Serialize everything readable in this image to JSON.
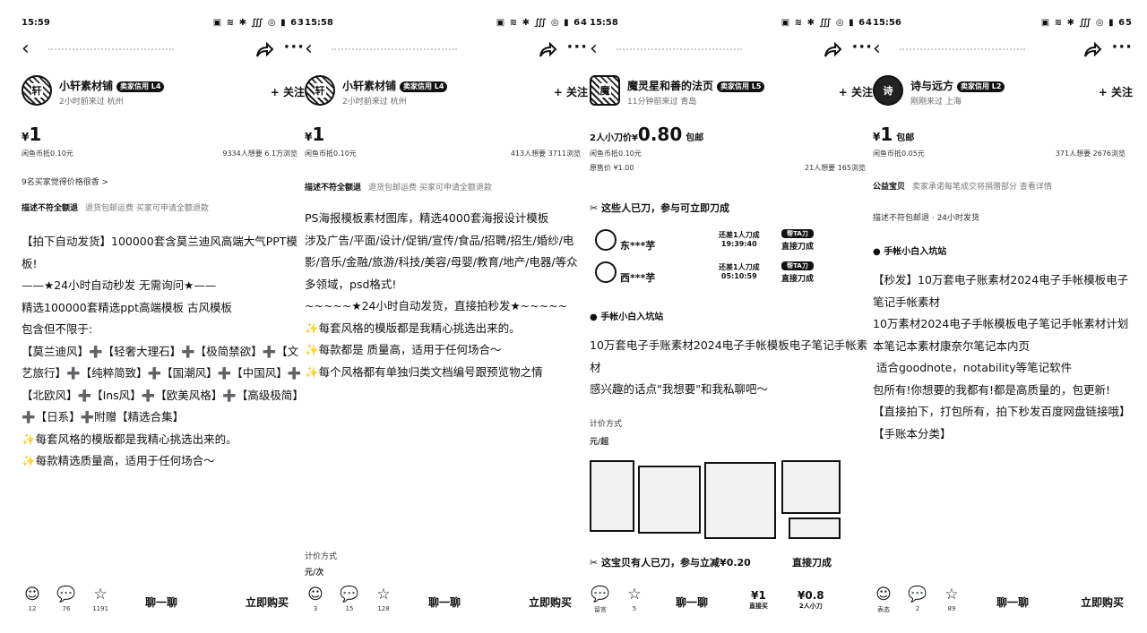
{
  "panels": [
    {
      "time": "15:59",
      "status_icons": "▣ ≋ ✱ ∭ ◎ ▮ 63",
      "seller_name": "小轩素材铺",
      "badge": "卖家信用 L4",
      "seller_meta": "2小时前来过  杭州",
      "follow": "+ 关注",
      "price_currency": "¥",
      "price": "1",
      "price_suffix": "",
      "price_sub": "闲鱼币抵0.10元",
      "stats": "9334人想要  6.1万浏览",
      "line1": "9名买家觉得价格很香 >",
      "tag_label": "描述不符全额退",
      "tag_text": "退货包邮运费  买家可申请全额退款",
      "desc": [
        "【拍下自动发货】100000套含莫兰迪风高端大气PPT模板!",
        "",
        "——★24小时自动秒发 无需询问★——",
        "",
        "精选100000套精选ppt高端模板 古风模板",
        "包含但不限于:",
        "【莫兰迪风】➕【轻奢大理石】➕【极简禁欲】➕【文艺旅行】➕【纯粹简致】➕【国潮风】➕【中国风】➕【北欧风】➕【Ins风】➕【欧美风格】➕【高级极简】➕【日系】➕附赠【精选合集】",
        "",
        "✨每套风格的模版都是我精心挑选出来的。",
        "",
        "✨每款精选质量高，适用于任何场合～"
      ],
      "counts": [
        "12",
        "76",
        "1191"
      ],
      "chat": "聊一聊",
      "buy": "立即购买"
    },
    {
      "time": "15:58",
      "status_icons": "▣ ≋ ✱ ∭ ◎ ▮ 64",
      "seller_name": "小轩素材铺",
      "badge": "卖家信用 L4",
      "seller_meta": "2小时前来过  杭州",
      "follow": "+ 关注",
      "price_currency": "¥",
      "price": "1",
      "price_suffix": "",
      "price_sub": "闲鱼币抵0.10元",
      "stats": "413人想要  3711浏览",
      "tag_label": "描述不符全额退",
      "tag_text": "退货包邮运费  买家可申请全额退款",
      "desc": [
        "PS海报模板素材图库，精选4000套海报设计模板",
        "涉及广告/平面/设计/促销/宣传/食品/招聘/招生/婚纱/电影/音乐/金融/旅游/科技/美容/母婴/教育/地产/电器/等众多领域，psd格式!",
        "",
        "~~~~~★24小时自动发货，直接拍秒发★~~~~~",
        "",
        "✨每套风格的模版都是我精心挑选出来的。",
        "",
        "✨每款都是 质量高，适用于任何场合～",
        "",
        "✨每个风格都有单独归类文档编号跟预览物之情"
      ],
      "pricing_label": "计价方式",
      "pricing_value": "元/次",
      "counts": [
        "3",
        "15",
        "128"
      ],
      "chat": "聊一聊",
      "buy": "立即购买"
    },
    {
      "time": "15:58",
      "status_icons": "▣ ≋ ✱ ∭ ◎ ▮ 64",
      "seller_name": "魔灵星和善的法页",
      "badge": "卖家信用 L5",
      "seller_meta": "11分钟前来过  青岛",
      "follow": "+ 关注",
      "price_prefix": "2人小刀价¥",
      "price": "0.80",
      "price_suffix": "包邮",
      "price_sub": "闲鱼币抵0.10元",
      "price_orig": "原售价 ¥1.00",
      "stats": "21人想要  165浏览",
      "cut_title": "这些人已刀，参与可立即刀成",
      "helpers": [
        {
          "name": "东***芋",
          "need": "还差1人刀成",
          "time": "19:39:40",
          "btn_label": "帮TA刀",
          "btn": "直接刀成"
        },
        {
          "name": "西***芋",
          "need": "还差1人刀成",
          "time": "05:10:59",
          "btn_label": "帮TA刀",
          "btn": "直接刀成"
        }
      ],
      "shop_name": "手帐小白入坑站",
      "desc": [
        "10万套电子手账素材2024电子手帐模板电子笔记手帐素材",
        "感兴趣的话点\"我想要\"和我私聊吧～"
      ],
      "pricing_label": "计价方式",
      "pricing_value": "元/超",
      "cut_banner": "这宝贝有人已刀，参与立减¥0.20",
      "cut_banner_btn": "直接刀成",
      "counts": [
        "留言",
        "5"
      ],
      "chat": "聊一聊",
      "buy_price": "¥1",
      "buy_price_label": "直接买",
      "cut_price": "¥0.8",
      "cut_price_label": "2人小刀"
    },
    {
      "time": "15:56",
      "status_icons": "▣ ≋ ✱ ∭ ◎ ▮ 65",
      "seller_name": "诗与远方",
      "badge": "卖家信用 L2",
      "seller_meta": "刚刚来过  上海",
      "follow": "+ 关注",
      "price_currency": "¥",
      "price": "1",
      "price_suffix": "包邮",
      "price_sub": "闲鱼币抵0.05元",
      "stats": "371人想要  2676浏览",
      "promo_label": "公益宝贝",
      "promo_text": "卖家承诺每笔成交将捐赠部分  查看详情",
      "line1": "描述不符包邮退 · 24小时发货",
      "shop_name": "手帐小白入坑站",
      "desc": [
        "【秒发】10万套电子账素材2024电子手帐模板电子笔记手帐素材",
        "",
        "10万素材2024电子手帐模板电子笔记手帐素材计划本笔记本素材康奈尔笔记本内页",
        " 适合goodnote，notability等笔记软件",
        "包所有!你想要的我都有!都是高质量的，包更新!",
        "",
        "",
        "【直接拍下，打包所有，拍下秒发百度网盘链接哦】",
        "",
        "【手账本分类】"
      ],
      "counts": [
        "表态",
        "2",
        "89"
      ],
      "chat": "聊一聊",
      "buy": "立即购买"
    }
  ]
}
